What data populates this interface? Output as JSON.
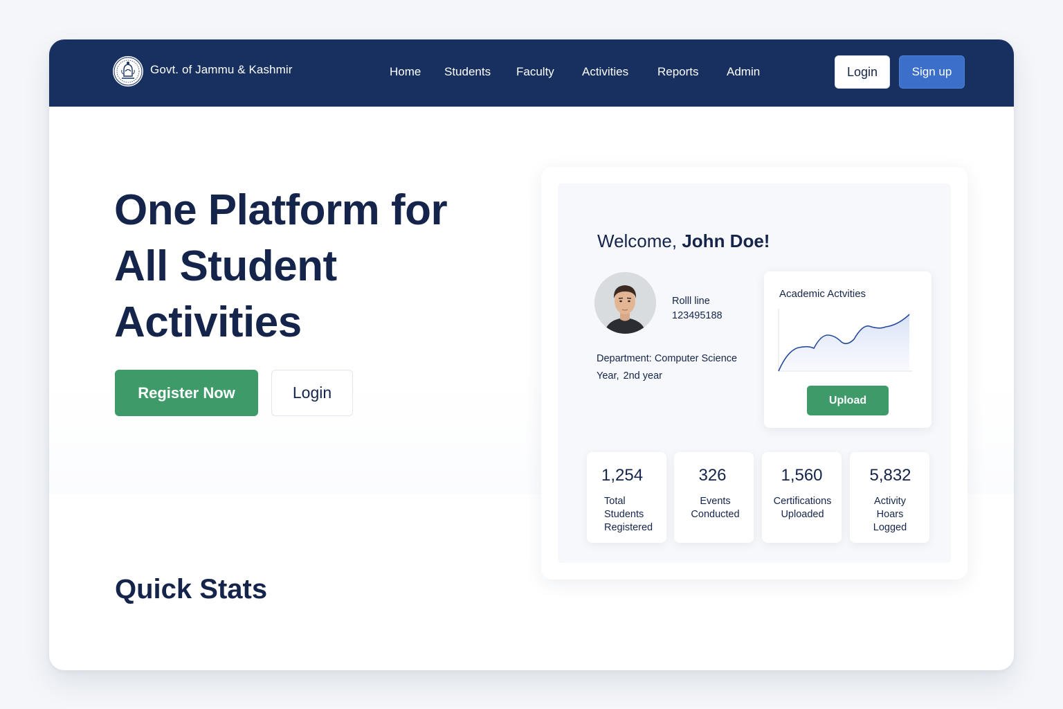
{
  "header": {
    "brand": "Govt. of Jammu & Kashmir",
    "nav": [
      "Home",
      "Students",
      "Faculty",
      "Activities",
      "Reports",
      "Admin"
    ],
    "login_label": "Login",
    "signup_label": "Sign up"
  },
  "hero": {
    "title_line1": "One Platform for",
    "title_line2": "All Student",
    "title_line3": "Activities",
    "register_label": "Register Now",
    "login_label": "Login"
  },
  "quick_stats_heading": "Quick Stats",
  "dashboard": {
    "welcome_prefix": "Welcome,",
    "welcome_name": "John Doe!",
    "roll_label": "Rolll line",
    "roll_value": "123495188",
    "department": "Department: Computer Science",
    "year_label": "Year,",
    "year_value": "2nd year",
    "activity_title": "Academic Actvities",
    "upload_label": "Upload",
    "stats": [
      {
        "value": "1,254",
        "label_lines": [
          "Total",
          "Students",
          "Registered"
        ]
      },
      {
        "value": "326",
        "label_lines": [
          "Events",
          "Conducted"
        ]
      },
      {
        "value": "1,560",
        "label_lines": [
          "Certifications",
          "Uploaded"
        ]
      },
      {
        "value": "5,832",
        "label_lines": [
          "Activity",
          "Hoars",
          "Logged"
        ]
      }
    ]
  },
  "icons": {
    "emblem": "emblem-icon",
    "avatar": "avatar"
  },
  "colors": {
    "navbar": "#17305f",
    "primary_text": "#14244a",
    "green": "#3f9a6a",
    "blue": "#3b6fca"
  }
}
